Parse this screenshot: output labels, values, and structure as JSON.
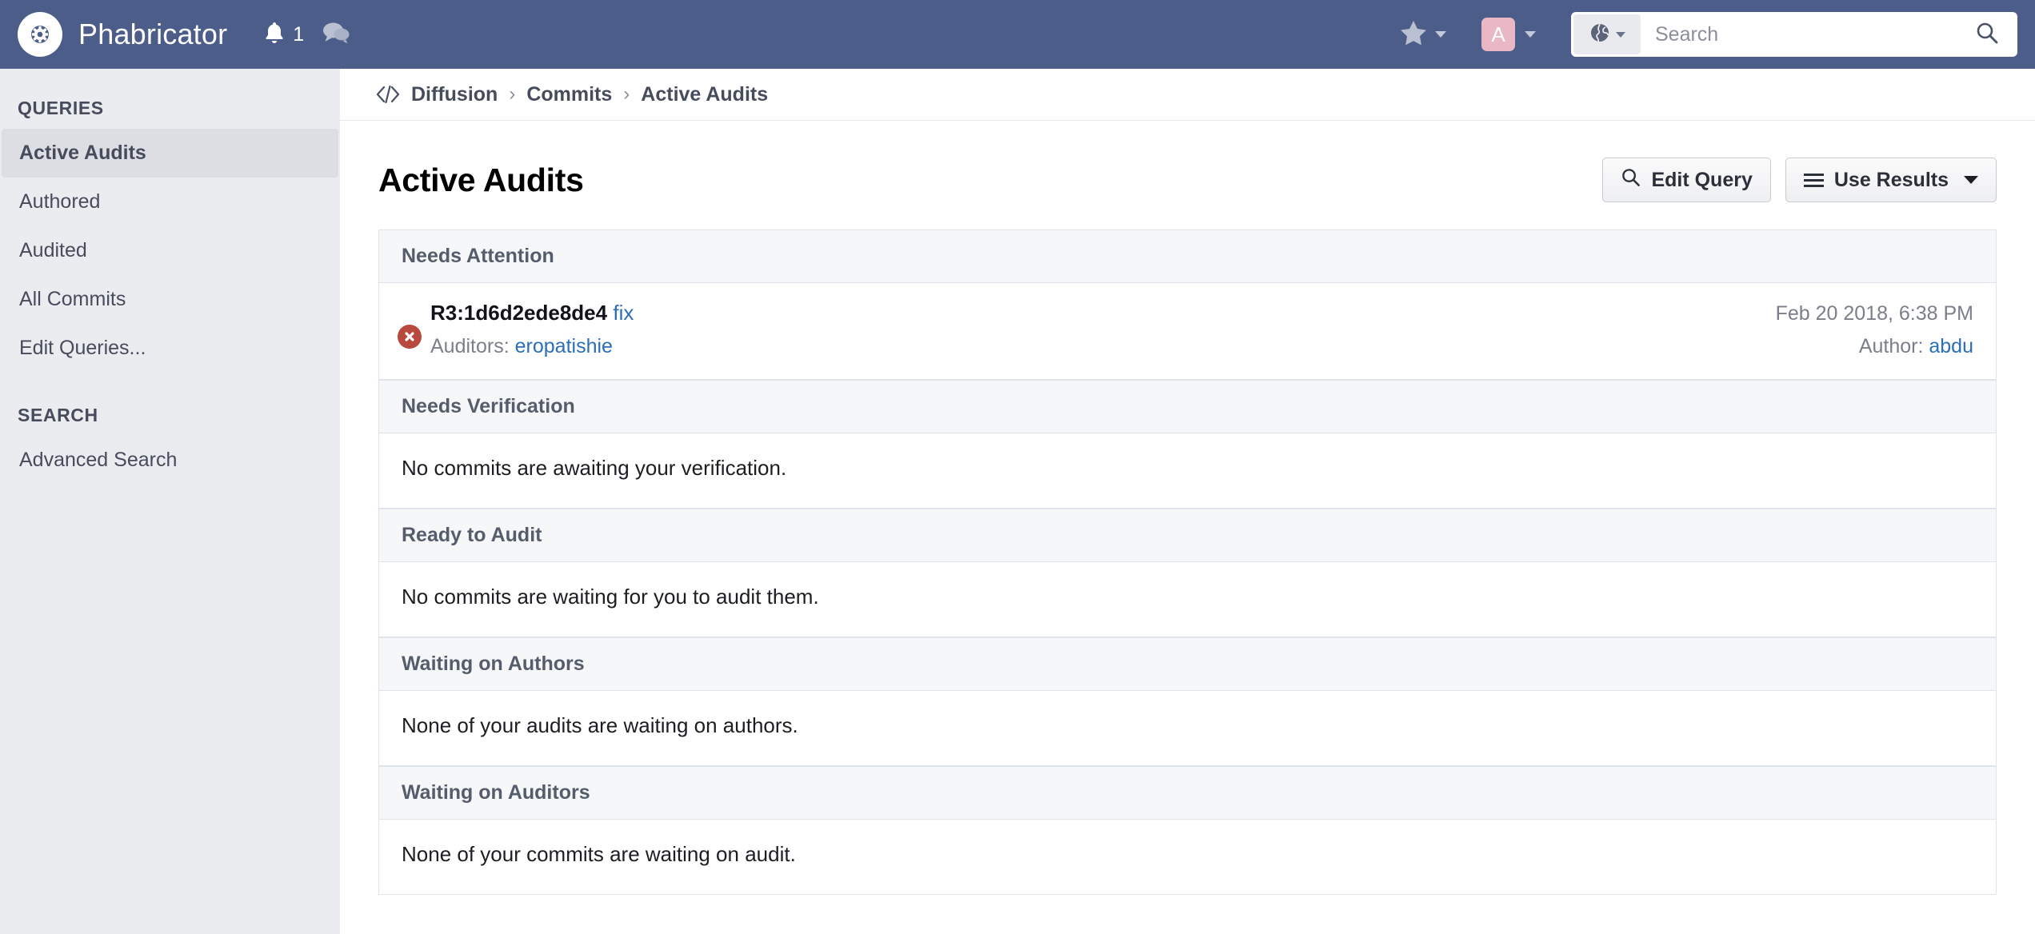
{
  "header": {
    "brand": "Phabricator",
    "logo_icon": "phabricator-eye-gear-icon",
    "notifications_icon": "bell-icon",
    "notifications_count": "1",
    "messages_icon": "chat-bubbles-icon",
    "favorites_icon": "star-icon",
    "favorites_caret_icon": "chevron-down-icon",
    "avatar_initial": "A",
    "avatar_caret_icon": "chevron-down-icon",
    "search": {
      "scope_icon": "globe-icon",
      "scope_caret_icon": "chevron-down-icon",
      "placeholder": "Search",
      "value": "",
      "submit_icon": "search-icon"
    }
  },
  "sidebar": {
    "queries_label": "QUERIES",
    "queries": [
      {
        "label": "Active Audits",
        "active": true
      },
      {
        "label": "Authored",
        "active": false
      },
      {
        "label": "Audited",
        "active": false
      },
      {
        "label": "All Commits",
        "active": false
      },
      {
        "label": "Edit Queries...",
        "active": false
      }
    ],
    "search_label": "SEARCH",
    "search_items": [
      {
        "label": "Advanced Search",
        "active": false
      }
    ]
  },
  "breadcrumb": {
    "icon": "code-brackets-icon",
    "items": [
      "Diffusion",
      "Commits",
      "Active Audits"
    ],
    "separator": "›"
  },
  "page": {
    "title": "Active Audits",
    "actions": {
      "edit_query_label": "Edit Query",
      "edit_query_icon": "search-icon",
      "use_results_label": "Use Results",
      "use_results_icon": "hamburger-icon",
      "use_results_caret_icon": "caret-down-icon"
    }
  },
  "sections": [
    {
      "title": "Needs Attention",
      "empty_text": null,
      "commits": [
        {
          "status_icon": "red-x-circle-icon",
          "identifier": "R3:1d6d2ede8de4",
          "summary": "fix",
          "auditors_label": "Auditors:",
          "auditors": "eropatishie",
          "date": "Feb 20 2018, 6:38 PM",
          "author_label": "Author:",
          "author": "abdu"
        }
      ]
    },
    {
      "title": "Needs Verification",
      "empty_text": "No commits are awaiting your verification.",
      "commits": []
    },
    {
      "title": "Ready to Audit",
      "empty_text": "No commits are waiting for you to audit them.",
      "commits": []
    },
    {
      "title": "Waiting on Authors",
      "empty_text": "None of your audits are waiting on authors.",
      "commits": []
    },
    {
      "title": "Waiting on Auditors",
      "empty_text": "None of your commits are waiting on audit.",
      "commits": []
    }
  ],
  "colors": {
    "header_bg": "#4b5d88",
    "sidebar_bg": "#ebecf0",
    "sidebar_active_bg": "#dcdee4",
    "link": "#2a6fb8",
    "status_red": "#b84a3d",
    "avatar_bg": "#eab8c4",
    "section_head_bg": "#f6f7f8",
    "border": "#dfe3ea"
  }
}
